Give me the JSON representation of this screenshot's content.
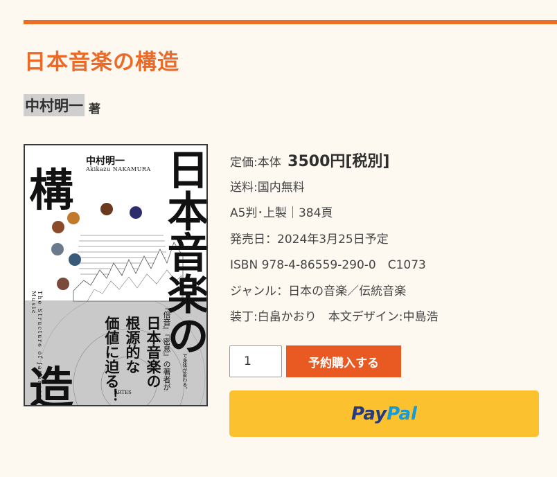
{
  "product": {
    "title": "日本音楽の構造",
    "author_name": "中村明一",
    "author_role": "著"
  },
  "cover": {
    "title_chars": [
      "構",
      "造"
    ],
    "title_vertical": "日本音楽の",
    "author_jp": "中村明一",
    "author_en": "Akikazu NAKAMURA",
    "subtitle_en": "The Structure of Japanese Music",
    "tagline_lines": [
      "日本音楽の",
      "根源的な",
      "価値に迫る！"
    ],
    "note_lines": [
      "『倍音』『密息』の著者が",
      "で身体が変わる。"
    ],
    "publisher": "ARTES"
  },
  "details": {
    "price_label": "定価:本体",
    "price_value": "3500円",
    "price_tax": "[税別]",
    "shipping": "送料:国内無料",
    "format": "A5判･上製｜384頁",
    "release": "発売日：2024年3月25日予定",
    "isbn": "ISBN 978-4-86559-290-0　C1073",
    "genre": "ジャンル：日本の音楽／伝統音楽",
    "design": "装丁:白畠かおり　本文デザイン:中島浩"
  },
  "purchase": {
    "quantity": "1",
    "buy_label": "予約購入する",
    "paypal_part1": "Pay",
    "paypal_part2": "Pal"
  },
  "colors": {
    "accent": "#ee6d24",
    "buy_button": "#e85a22",
    "paypal_button": "#fcc12e",
    "background": "#fdf8f0"
  }
}
